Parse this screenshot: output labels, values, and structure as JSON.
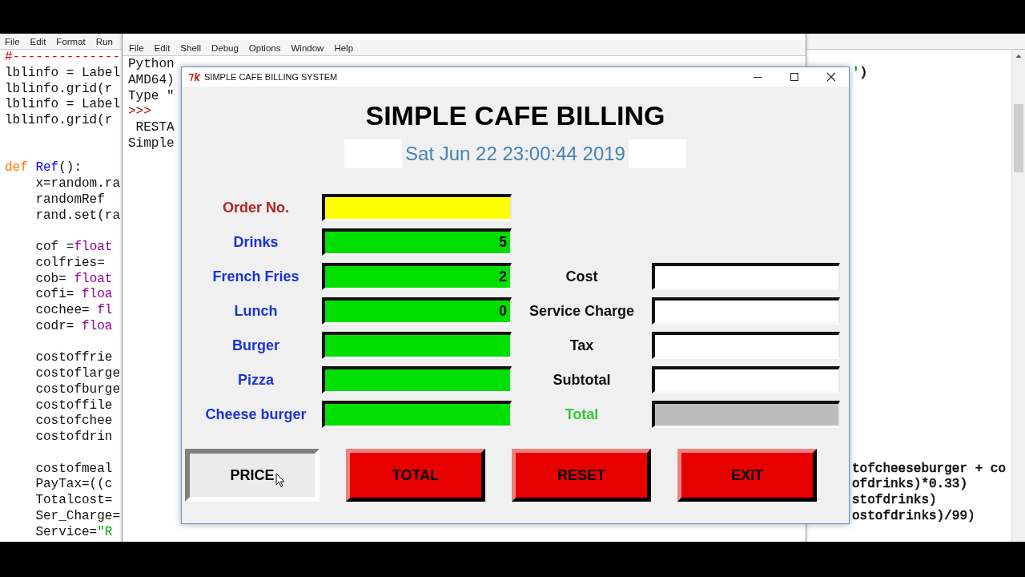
{
  "editor": {
    "menu": [
      "File",
      "Edit",
      "Format",
      "Run"
    ],
    "lines": [
      {
        "kind": "code",
        "segments": [
          {
            "text": "#--------------",
            "color": "#dd0000"
          }
        ]
      },
      {
        "kind": "code",
        "segments": [
          {
            "text": "lblinfo = Label",
            "color": "#111111"
          }
        ],
        "right": [
          {
            "text": "'",
            "color": "#00aa00"
          },
          {
            "text": ")",
            "color": "#111111"
          }
        ]
      },
      {
        "kind": "code",
        "segments": [
          {
            "text": "lblinfo.grid(r",
            "color": "#111111"
          }
        ]
      },
      {
        "kind": "code",
        "segments": [
          {
            "text": "lblinfo = Label",
            "color": "#111111"
          }
        ]
      },
      {
        "kind": "code",
        "segments": [
          {
            "text": "lblinfo.grid(r",
            "color": "#111111"
          }
        ]
      },
      {
        "kind": "blank"
      },
      {
        "kind": "blank"
      },
      {
        "kind": "code",
        "segments": [
          {
            "text": "def ",
            "color": "#ff7700"
          },
          {
            "text": "Ref",
            "color": "#0000ff"
          },
          {
            "text": "():",
            "color": "#111111"
          }
        ]
      },
      {
        "kind": "code",
        "segments": [
          {
            "text": "    x=random.ra",
            "color": "#111111"
          }
        ]
      },
      {
        "kind": "code",
        "segments": [
          {
            "text": "    randomRef",
            "color": "#111111"
          }
        ]
      },
      {
        "kind": "code",
        "segments": [
          {
            "text": "    rand.set(ra",
            "color": "#111111"
          }
        ]
      },
      {
        "kind": "blank"
      },
      {
        "kind": "code",
        "segments": [
          {
            "text": "    cof =",
            "color": "#111111"
          },
          {
            "text": "float",
            "color": "#900090"
          }
        ]
      },
      {
        "kind": "code",
        "segments": [
          {
            "text": "    colfries=",
            "color": "#111111"
          }
        ]
      },
      {
        "kind": "code",
        "segments": [
          {
            "text": "    cob= ",
            "color": "#111111"
          },
          {
            "text": "float",
            "color": "#900090"
          }
        ]
      },
      {
        "kind": "code",
        "segments": [
          {
            "text": "    cofi= ",
            "color": "#111111"
          },
          {
            "text": "floa",
            "color": "#900090"
          }
        ]
      },
      {
        "kind": "code",
        "segments": [
          {
            "text": "    cochee= ",
            "color": "#111111"
          },
          {
            "text": "fl",
            "color": "#900090"
          }
        ]
      },
      {
        "kind": "code",
        "segments": [
          {
            "text": "    codr= ",
            "color": "#111111"
          },
          {
            "text": "floa",
            "color": "#900090"
          }
        ]
      },
      {
        "kind": "blank"
      },
      {
        "kind": "code",
        "segments": [
          {
            "text": "    costoffrie",
            "color": "#111111"
          }
        ]
      },
      {
        "kind": "code",
        "segments": [
          {
            "text": "    costoflarge",
            "color": "#111111"
          }
        ]
      },
      {
        "kind": "code",
        "segments": [
          {
            "text": "    costofburge",
            "color": "#111111"
          }
        ]
      },
      {
        "kind": "code",
        "segments": [
          {
            "text": "    costoffile",
            "color": "#111111"
          }
        ]
      },
      {
        "kind": "code",
        "segments": [
          {
            "text": "    costofchee",
            "color": "#111111"
          }
        ]
      },
      {
        "kind": "code",
        "segments": [
          {
            "text": "    costofdrin",
            "color": "#111111"
          }
        ]
      },
      {
        "kind": "blank"
      },
      {
        "kind": "code",
        "segments": [
          {
            "text": "    costofmeal",
            "color": "#111111"
          }
        ],
        "right": [
          {
            "text": "tofcheeseburger + co",
            "color": "#111111"
          }
        ]
      },
      {
        "kind": "code",
        "segments": [
          {
            "text": "    PayTax=((c",
            "color": "#111111"
          }
        ],
        "right": [
          {
            "text": "ofdrinks)*0.33)",
            "color": "#111111"
          }
        ]
      },
      {
        "kind": "code",
        "segments": [
          {
            "text": "    Totalcost=",
            "color": "#111111"
          }
        ],
        "right": [
          {
            "text": "stofdrinks)",
            "color": "#111111"
          }
        ]
      },
      {
        "kind": "code",
        "segments": [
          {
            "text": "    Ser_Charge=",
            "color": "#111111"
          }
        ],
        "right": [
          {
            "text": "ostofdrinks)/99)",
            "color": "#111111"
          }
        ]
      },
      {
        "kind": "code",
        "segments": [
          {
            "text": "    Service=",
            "color": "#111111"
          },
          {
            "text": "\"R",
            "color": "#00aa00"
          }
        ]
      }
    ]
  },
  "shell": {
    "menu": [
      "File",
      "Edit",
      "Shell",
      "Debug",
      "Options",
      "Window",
      "Help"
    ],
    "lines": [
      {
        "text": "Python",
        "kind": "output"
      },
      {
        "text": "AMD64)",
        "kind": "output"
      },
      {
        "text": "Type \"",
        "kind": "output"
      },
      {
        "text": ">>>",
        "kind": "prompt"
      },
      {
        "text": " RESTA",
        "kind": "output"
      },
      {
        "text": "Simple",
        "kind": "output"
      }
    ]
  },
  "app": {
    "window": {
      "title": "SIMPLE CAFE BILLING SYSTEM"
    },
    "heading": "SIMPLE CAFE BILLING",
    "date": "Sat Jun 22 23:00:44 2019",
    "rows": [
      {
        "left": {
          "label": "Order No.",
          "kind": "order"
        }
      },
      {
        "left": {
          "label": "Drinks",
          "kind": "item",
          "value": "5"
        }
      },
      {
        "left": {
          "label": "French Fries",
          "kind": "item",
          "value": "2"
        },
        "right": {
          "label": "Cost",
          "kind": "charge"
        }
      },
      {
        "left": {
          "label": "Lunch",
          "kind": "item",
          "value": "0"
        },
        "right": {
          "label": "Service Charge",
          "kind": "charge"
        }
      },
      {
        "left": {
          "label": "Burger",
          "kind": "item"
        },
        "right": {
          "label": "Tax",
          "kind": "charge"
        }
      },
      {
        "left": {
          "label": "Pizza",
          "kind": "item"
        },
        "right": {
          "label": "Subtotal",
          "kind": "charge"
        }
      },
      {
        "left": {
          "label": "Cheese burger",
          "kind": "item"
        },
        "right": {
          "label": "Total",
          "kind": "total"
        }
      }
    ],
    "buttons": [
      {
        "label": "PRICE",
        "pressed": true
      },
      {
        "label": "TOTAL",
        "pressed": false
      },
      {
        "label": "RESET",
        "pressed": false
      },
      {
        "label": "EXIT",
        "pressed": false
      }
    ]
  }
}
